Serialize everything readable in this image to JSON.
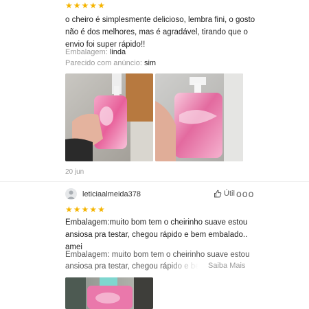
{
  "review1": {
    "rating": 5,
    "text": "o cheiro é simplesmente delicioso, lembra fini, o gosto não é dos melhores, mas é agradável, tirando que o envio foi super rápido!!",
    "attributes": [
      {
        "key": "Embalagem:",
        "value": "linda"
      },
      {
        "key": "Parecido com anúncio:",
        "value": "sim"
      }
    ],
    "photos": [
      "photo-1",
      "photo-2"
    ],
    "date": "20 jun"
  },
  "review2": {
    "username": "leticiaalmeida378",
    "useful_label": "Útil",
    "more_label": "ooo",
    "rating": 5,
    "text": "Embalagem:muito bom tem o cheirinho suave estou ansiosa pra testar, chegou rápido e bem embalado.. amei",
    "translation_line1": "Embalagem: muito bom tem o cheirinho suave estou",
    "translation_line2": "ansiosa pra testar, chegou rápido e bem e",
    "saiba_mais": "Saiba Mais"
  },
  "icons": {
    "star": "star-icon",
    "thumbs_up": "thumbs-up-icon",
    "avatar": "user-avatar-icon",
    "more": "more-options-icon"
  },
  "colors": {
    "star": "#f5b400",
    "muted": "#9a9a9a",
    "product_pink": "#e8609a"
  }
}
